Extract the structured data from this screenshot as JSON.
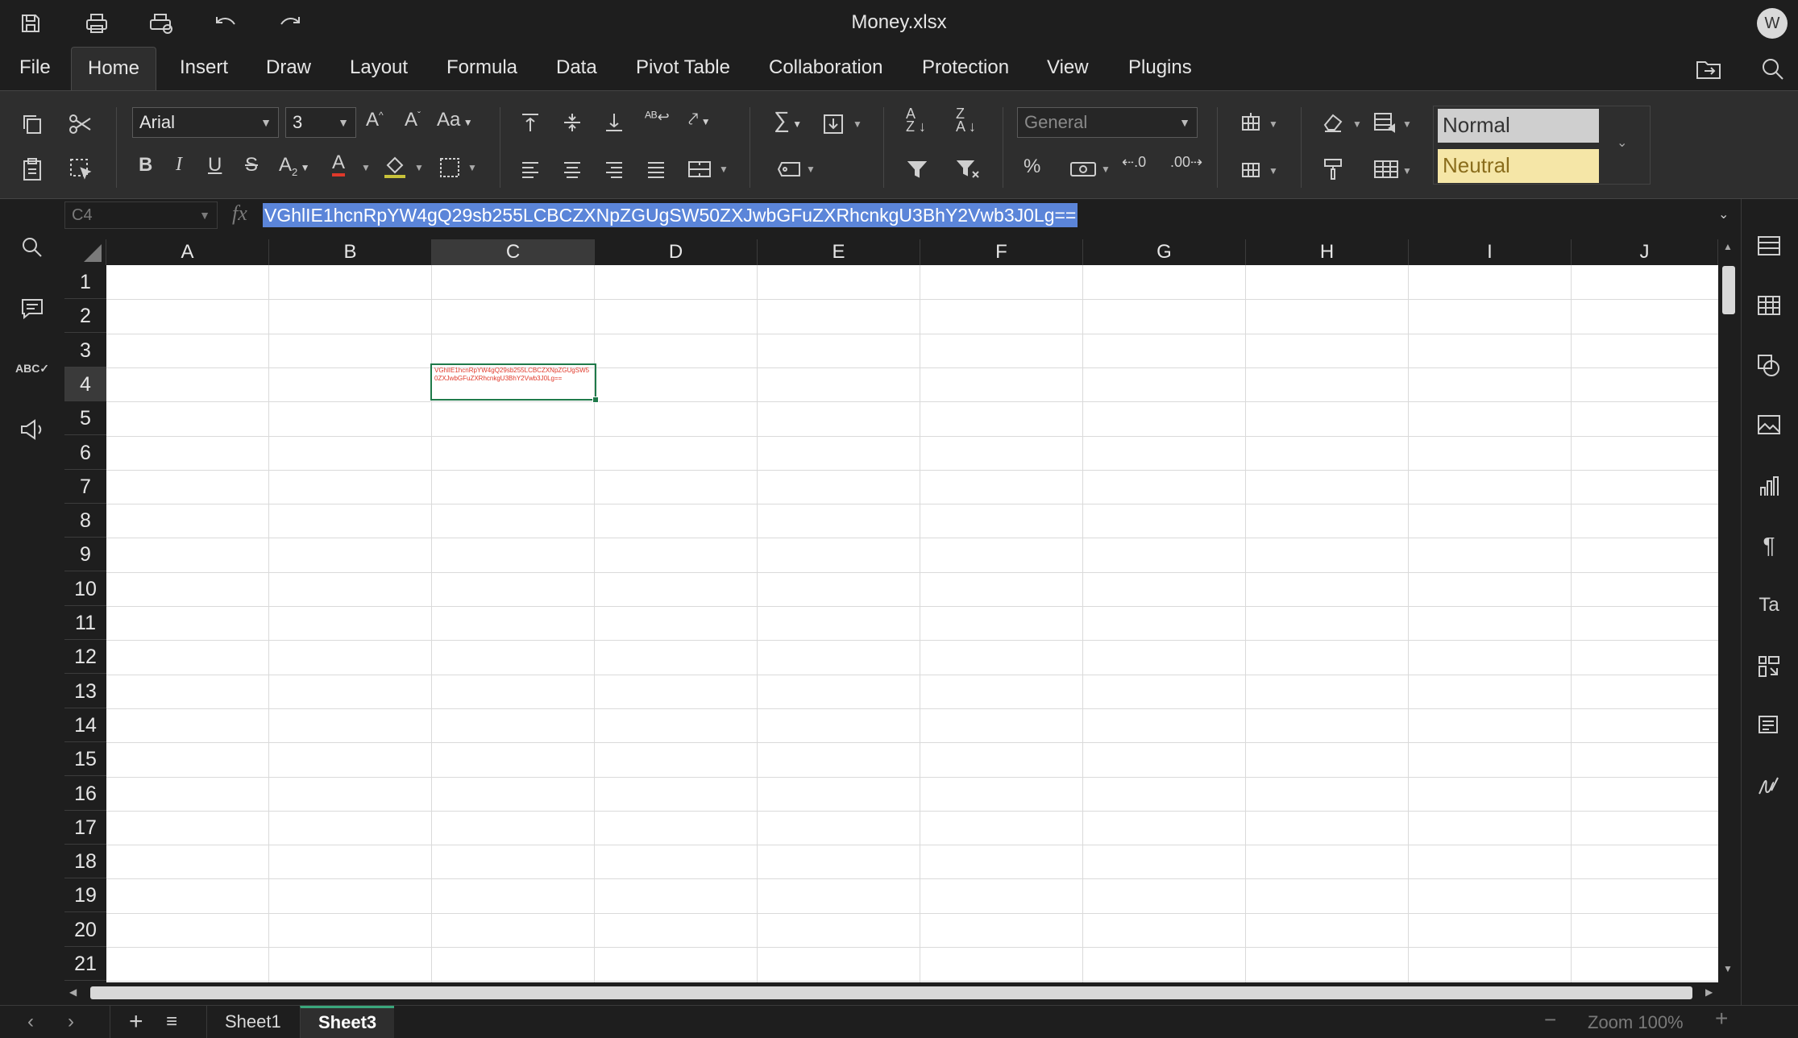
{
  "window": {
    "title": "Money.xlsx",
    "user_initial": "W"
  },
  "menu": {
    "tabs": [
      "File",
      "Home",
      "Insert",
      "Draw",
      "Layout",
      "Formula",
      "Data",
      "Pivot Table",
      "Collaboration",
      "Protection",
      "View",
      "Plugins"
    ],
    "active_tab": "Home"
  },
  "toolbar": {
    "font_name": "Arial",
    "font_size": "3",
    "number_format": "General",
    "styles": [
      {
        "label": "Normal",
        "bg": "#cfcfcf",
        "color": "#333333"
      },
      {
        "label": "Neutral",
        "bg": "#f5e6a7",
        "color": "#8a6d1c"
      }
    ]
  },
  "formula_bar": {
    "name_box": "C4",
    "fx": "fx",
    "content": "VGhlIE1hcnRpYW4gQ29sb255LCBCZXNpZGUgSW50ZXJwbGFuZXRhcnkgU3BhY2Vwb3J0Lg=="
  },
  "sheet": {
    "columns": [
      "A",
      "B",
      "C",
      "D",
      "E",
      "F",
      "G",
      "H",
      "I",
      "J"
    ],
    "rows": [
      "1",
      "2",
      "3",
      "4",
      "5",
      "6",
      "7",
      "8",
      "9",
      "10",
      "11",
      "12",
      "13",
      "14",
      "15",
      "16",
      "17",
      "18",
      "19",
      "20",
      "21"
    ],
    "active_column": "C",
    "active_row": "4",
    "active_cell_text": "VGhlIE1hcnRpYW4gQ29sb255LCBCZXNpZGUgSW50ZXJwbGFuZXRhcnkgU3BhY2Vwb3J0Lg==",
    "text_color": "#e0392a"
  },
  "status": {
    "sheets": [
      "Sheet1",
      "Sheet3"
    ],
    "active_sheet": "Sheet3",
    "zoom": "Zoom 100%"
  }
}
